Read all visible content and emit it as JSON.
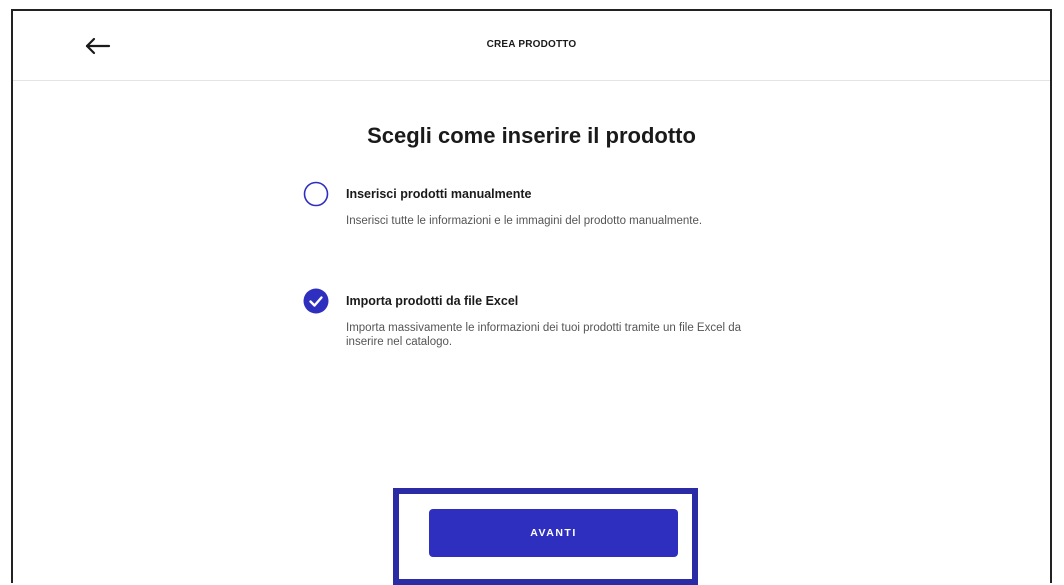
{
  "header": {
    "title": "CREA PRODOTTO",
    "back_icon": "arrow-left-icon"
  },
  "main": {
    "heading": "Scegli come inserire il prodotto",
    "options": [
      {
        "title": "Inserisci prodotti manualmente",
        "description": "Inserisci tutte le informazioni e le immagini del prodotto manualmente.",
        "selected": false
      },
      {
        "title": "Importa prodotti da file Excel",
        "description": "Importa massivamente le informazioni dei tuoi prodotti tramite un file Excel da inserire nel catalogo.",
        "selected": true
      }
    ]
  },
  "footer": {
    "next_label": "AVANTI"
  },
  "colors": {
    "accent": "#2f2fbf",
    "highlight_border": "#2c2ba6",
    "text": "#1a1a1a",
    "muted_text": "#555555"
  }
}
